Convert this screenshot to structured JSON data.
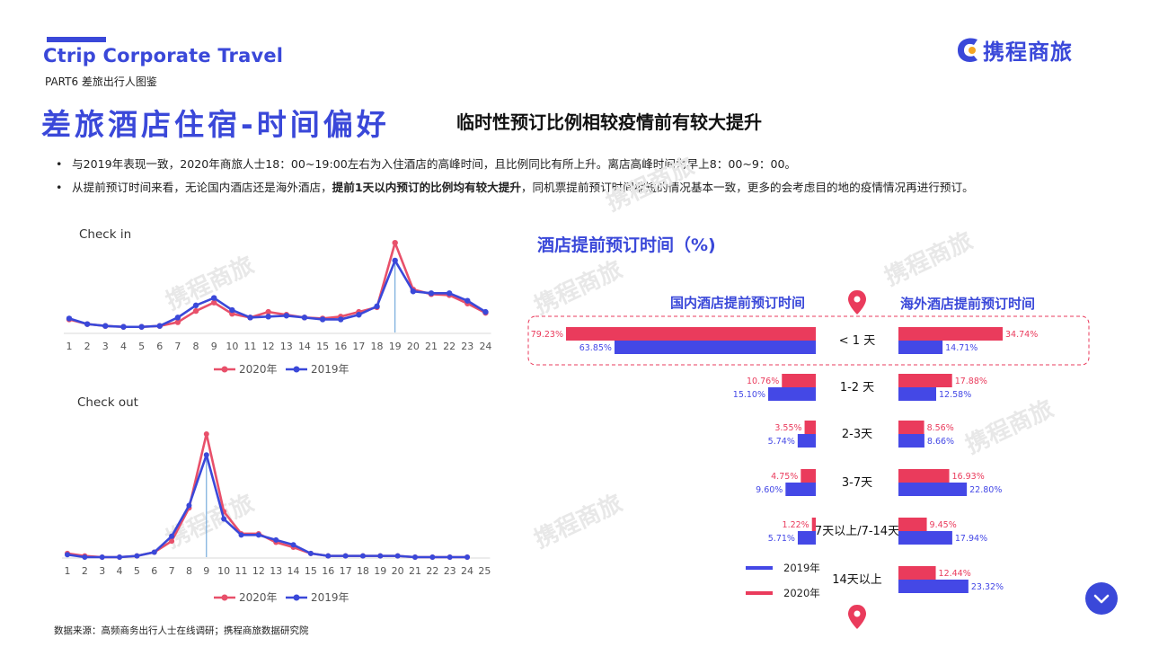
{
  "header": {
    "brand": "Ctrip Corporate Travel",
    "part": "PART6 差旅出行人图鉴",
    "logo_text": "携程商旅",
    "title": "差旅酒店住宿-时间偏好",
    "subtitle": "临时性预订比例相较疫情前有较大提升"
  },
  "bullets": {
    "b1": "与2019年表现一致，2020年商旅人士18：00~19:00左右为入住酒店的高峰时间，且比例同比有所上升。离店高峰时间为早上8：00~9：00。",
    "b2_pre": "从提前预订时间来看，无论国内酒店还是海外酒店，",
    "b2_bold": "提前1天以内预订的比例均有较大提升",
    "b2_post": "，同机票提前预订时间缩短的情况基本一致，更多的会考虑目的地的疫情情况再进行预订。"
  },
  "watermark": "携程商旅",
  "source": "数据来源：高频商务出行人士在线调研；携程商旅数据研究院",
  "colors": {
    "accent": "#3a48d9",
    "series_2020": "#e8506a",
    "series_2019": "#3a48d9",
    "bar_2020": "#ea3b5c",
    "bar_2019": "#4448e6"
  },
  "icons": {
    "pin": "map-pin-icon",
    "fab": "chevron-down-icon"
  },
  "chart_data": [
    {
      "type": "line",
      "title": "Check in",
      "x": [
        "1",
        "2",
        "3",
        "4",
        "5",
        "6",
        "7",
        "8",
        "9",
        "10",
        "11",
        "12",
        "13",
        "14",
        "15",
        "16",
        "17",
        "18",
        "19",
        "20",
        "21",
        "22",
        "23",
        "24"
      ],
      "ylim": [
        0,
        100
      ],
      "series": [
        {
          "name": "2020年",
          "values": [
            14,
            9,
            7,
            6,
            6,
            7,
            11,
            23,
            32,
            20,
            16,
            22,
            19,
            16,
            15,
            17,
            22,
            27,
            96,
            46,
            41,
            40,
            31,
            21
          ]
        },
        {
          "name": "2019年",
          "values": [
            15,
            9,
            7,
            6,
            6,
            7,
            16,
            29,
            37,
            24,
            16,
            17,
            18,
            16,
            14,
            14,
            19,
            28,
            77,
            44,
            42,
            42,
            34,
            22
          ]
        }
      ]
    },
    {
      "type": "line",
      "title": "Check out",
      "x": [
        "1",
        "2",
        "3",
        "4",
        "5",
        "6",
        "7",
        "8",
        "9",
        "10",
        "11",
        "12",
        "13",
        "14",
        "15",
        "16",
        "17",
        "18",
        "19",
        "20",
        "21",
        "22",
        "23",
        "24",
        "25"
      ],
      "ylim": [
        0,
        100
      ],
      "series": [
        {
          "name": "2020年",
          "values": [
            3,
            1,
            0,
            0,
            1,
            4,
            13,
            40,
            100,
            37,
            19,
            19,
            12,
            8,
            3,
            1,
            1,
            1,
            1,
            1,
            0,
            0,
            0,
            0
          ]
        },
        {
          "name": "2019年",
          "values": [
            2,
            0,
            0,
            0,
            1,
            4,
            17,
            42,
            83,
            31,
            18,
            18,
            14,
            10,
            3,
            1,
            1,
            1,
            1,
            1,
            0,
            0,
            0,
            0
          ]
        }
      ]
    },
    {
      "type": "bar",
      "title": "酒店提前预订时间（%)",
      "left_title": "国内酒店提前预订时间",
      "right_title": "海外酒店提前预订时间",
      "categories": [
        "< 1 天",
        "1-2 天",
        "2-3天",
        "3-7天",
        "7天以上/7-14天",
        "14天以上"
      ],
      "series": [
        {
          "name": "2020年",
          "domestic": [
            79.23,
            10.76,
            3.55,
            4.75,
            1.22,
            null
          ],
          "overseas": [
            34.74,
            17.88,
            8.56,
            16.93,
            9.45,
            12.44
          ]
        },
        {
          "name": "2019年",
          "domestic": [
            63.85,
            15.1,
            5.74,
            9.6,
            5.71,
            null
          ],
          "overseas": [
            14.71,
            12.58,
            8.66,
            22.8,
            17.94,
            23.32
          ]
        }
      ],
      "domestic_labels_2020": [
        "79.23%",
        "10.76%",
        "3.55%",
        "4.75%",
        "1.22%",
        ""
      ],
      "domestic_labels_2019": [
        "63.85%",
        "15.10%",
        "5.74%",
        "9.60%",
        "5.71%",
        ""
      ],
      "overseas_labels_2020": [
        "34.74%",
        "17.88%",
        "8.56%",
        "16.93%",
        "9.45%",
        "12.44%"
      ],
      "overseas_labels_2019": [
        "14.71%",
        "12.58%",
        "8.66%",
        "22.80%",
        "17.94%",
        "23.32%"
      ],
      "legend": [
        "2019年",
        "2020年"
      ]
    }
  ]
}
